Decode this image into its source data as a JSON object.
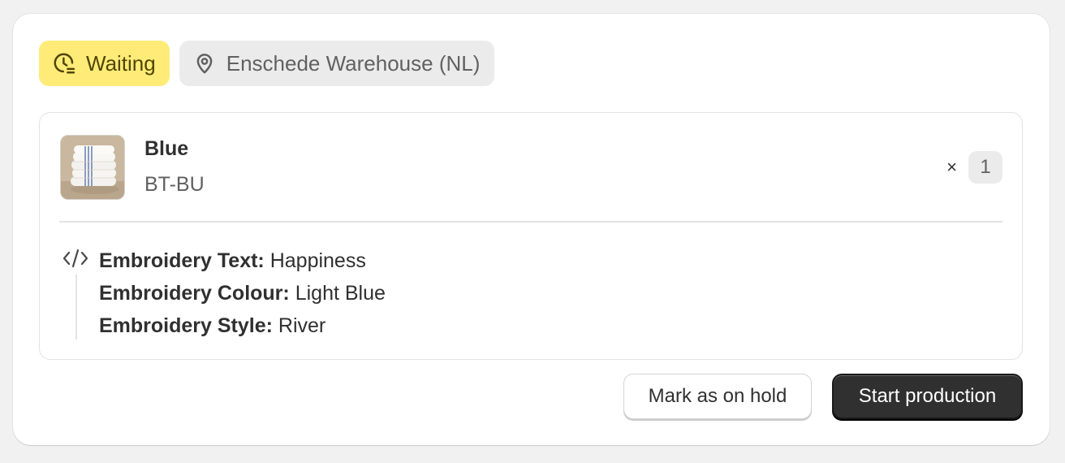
{
  "badges": {
    "status": {
      "label": "Waiting",
      "icon": "clock-icon",
      "color": "#ffeb78"
    },
    "location": {
      "label": "Enschede Warehouse (NL)",
      "icon": "location-pin-icon"
    }
  },
  "line_item": {
    "image_icon": "product-thumbnail",
    "title": "Blue",
    "sku": "BT-BU",
    "quantity_prefix": "×",
    "quantity": "1",
    "properties_icon": "code-icon",
    "properties": [
      {
        "key": "Embroidery Text:",
        "value": "Happiness"
      },
      {
        "key": "Embroidery Colour:",
        "value": "Light Blue"
      },
      {
        "key": "Embroidery Style:",
        "value": "River"
      }
    ]
  },
  "actions": {
    "secondary_label": "Mark as on hold",
    "primary_label": "Start production",
    "primary_color": "#303030"
  }
}
